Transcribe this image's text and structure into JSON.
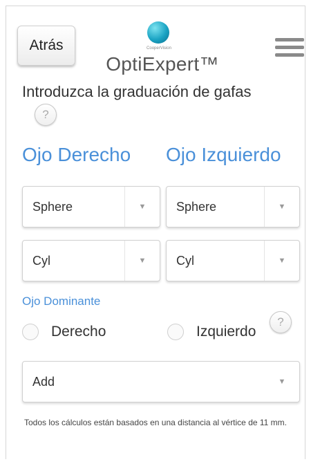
{
  "header": {
    "back_label": "Atrás",
    "logo_small": "CooperVision",
    "logo_name": "OptiExpert™",
    "help_glyph": "?"
  },
  "form": {
    "heading": "Introduzca la graduación de gafas",
    "right_eye_title": "Ojo Derecho",
    "left_eye_title": "Ojo Izquierdo",
    "right_sphere": "Sphere",
    "left_sphere": "Sphere",
    "right_cyl": "Cyl",
    "left_cyl": "Cyl",
    "arrow_glyph": "▼",
    "dominant_label": "Ojo Dominante",
    "radio_right": "Derecho",
    "radio_left": "Izquierdo",
    "add_label": "Add",
    "footnote": "Todos los cálculos están basados en una distancia al vértice de 11 mm."
  },
  "colors": {
    "accent": "#4a90d9",
    "logo": "#1aa3c3"
  },
  "icons": {
    "menu": "hamburger-menu-icon",
    "help": "question-mark-icon",
    "dropdown": "chevron-down-icon"
  }
}
